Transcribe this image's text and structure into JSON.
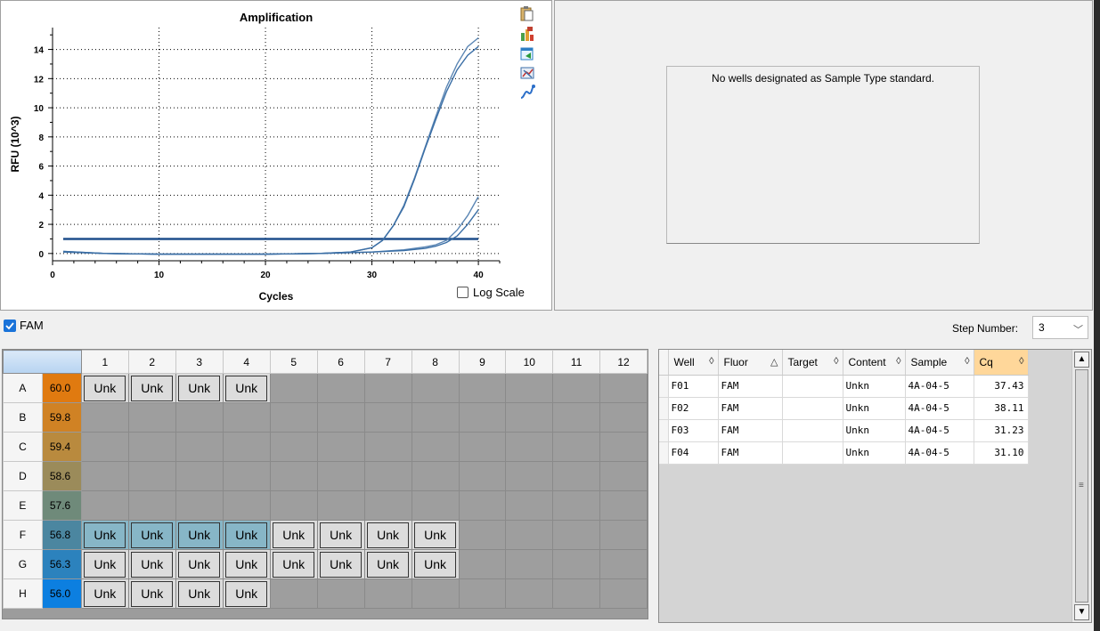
{
  "chart": {
    "title": "Amplification",
    "xlabel": "Cycles",
    "ylabel": "RFU (10^3)",
    "log_scale_label": "Log Scale",
    "tools": [
      "copy-icon",
      "export-chart-icon",
      "export-data-icon",
      "chart-settings-icon",
      "curve-icon"
    ]
  },
  "chart_data": {
    "type": "line",
    "title": "Amplification",
    "xlabel": "Cycles",
    "ylabel": "RFU (10^3)",
    "xlim": [
      0,
      42
    ],
    "ylim": [
      -0.5,
      15.5
    ],
    "xticks": [
      0,
      10,
      20,
      30,
      40
    ],
    "yticks": [
      0,
      2,
      4,
      6,
      8,
      10,
      12,
      14
    ],
    "grid": true,
    "threshold": 1.0,
    "series": [
      {
        "x": [
          1,
          5,
          10,
          15,
          20,
          25,
          28,
          30,
          31,
          32,
          33,
          34,
          35,
          36,
          37,
          38,
          39,
          40
        ],
        "y": [
          0.1,
          0,
          -0.05,
          -0.05,
          -0.05,
          0,
          0.1,
          0.4,
          0.9,
          1.9,
          3.3,
          5.2,
          7.3,
          9.4,
          11.4,
          13.0,
          14.2,
          14.8
        ]
      },
      {
        "x": [
          1,
          5,
          10,
          15,
          20,
          25,
          28,
          30,
          31,
          32,
          33,
          34,
          35,
          36,
          37,
          38,
          39,
          40
        ],
        "y": [
          0.1,
          0,
          -0.05,
          -0.05,
          -0.05,
          0,
          0.1,
          0.4,
          0.9,
          1.9,
          3.2,
          5.1,
          7.2,
          9.2,
          11.1,
          12.6,
          13.6,
          14.2
        ]
      },
      {
        "x": [
          1,
          5,
          10,
          15,
          20,
          25,
          30,
          33,
          35,
          36,
          37,
          38,
          39,
          40
        ],
        "y": [
          0.15,
          0,
          -0.05,
          -0.05,
          -0.05,
          0,
          0.1,
          0.25,
          0.45,
          0.6,
          0.9,
          1.6,
          2.6,
          3.9
        ]
      },
      {
        "x": [
          1,
          5,
          10,
          15,
          20,
          25,
          30,
          33,
          35,
          36,
          37,
          38,
          39,
          40
        ],
        "y": [
          0.15,
          0,
          -0.05,
          -0.05,
          -0.05,
          0,
          0.1,
          0.2,
          0.35,
          0.5,
          0.75,
          1.2,
          2.0,
          3.0
        ]
      }
    ]
  },
  "std_curve": {
    "message": "No wells designated as Sample Type standard."
  },
  "fluor": {
    "label": "FAM",
    "step_label": "Step Number:",
    "step_value": "3"
  },
  "plate": {
    "columns": [
      "1",
      "2",
      "3",
      "4",
      "5",
      "6",
      "7",
      "8",
      "9",
      "10",
      "11",
      "12"
    ],
    "rows": [
      {
        "row": "A",
        "temp": "60.0",
        "color": "#e07a10",
        "wells": [
          "Unk",
          "Unk",
          "Unk",
          "Unk",
          "",
          "",
          "",
          "",
          "",
          "",
          "",
          ""
        ],
        "sel": []
      },
      {
        "row": "B",
        "temp": "59.8",
        "color": "#d08224",
        "wells": [
          "",
          "",
          "",
          "",
          "",
          "",
          "",
          "",
          "",
          "",
          "",
          ""
        ],
        "sel": []
      },
      {
        "row": "C",
        "temp": "59.4",
        "color": "#b98a3e",
        "wells": [
          "",
          "",
          "",
          "",
          "",
          "",
          "",
          "",
          "",
          "",
          "",
          ""
        ],
        "sel": []
      },
      {
        "row": "D",
        "temp": "58.6",
        "color": "#9b8b5a",
        "wells": [
          "",
          "",
          "",
          "",
          "",
          "",
          "",
          "",
          "",
          "",
          "",
          ""
        ],
        "sel": []
      },
      {
        "row": "E",
        "temp": "57.6",
        "color": "#6f8a7a",
        "wells": [
          "",
          "",
          "",
          "",
          "",
          "",
          "",
          "",
          "",
          "",
          "",
          ""
        ],
        "sel": []
      },
      {
        "row": "F",
        "temp": "56.8",
        "color": "#4b86a0",
        "wells": [
          "Unk",
          "Unk",
          "Unk",
          "Unk",
          "Unk",
          "Unk",
          "Unk",
          "Unk",
          "",
          "",
          "",
          ""
        ],
        "sel": [
          0,
          1,
          2,
          3
        ]
      },
      {
        "row": "G",
        "temp": "56.3",
        "color": "#2c82bd",
        "wells": [
          "Unk",
          "Unk",
          "Unk",
          "Unk",
          "Unk",
          "Unk",
          "Unk",
          "Unk",
          "",
          "",
          "",
          ""
        ],
        "sel": []
      },
      {
        "row": "H",
        "temp": "56.0",
        "color": "#0c7fe0",
        "wells": [
          "Unk",
          "Unk",
          "Unk",
          "Unk",
          "",
          "",
          "",
          "",
          "",
          "",
          "",
          ""
        ],
        "sel": []
      }
    ]
  },
  "results": {
    "headers": [
      {
        "label": "Well",
        "sort": "◊"
      },
      {
        "label": "Fluor",
        "sort": "△"
      },
      {
        "label": "Target",
        "sort": "◊"
      },
      {
        "label": "Content",
        "sort": "◊"
      },
      {
        "label": "Sample",
        "sort": "◊"
      },
      {
        "label": "Cq",
        "sort": "◊"
      }
    ],
    "rows": [
      [
        "F01",
        "FAM",
        "",
        "Unkn",
        "4A-04-5",
        "37.43"
      ],
      [
        "F02",
        "FAM",
        "",
        "Unkn",
        "4A-04-5",
        "38.11"
      ],
      [
        "F03",
        "FAM",
        "",
        "Unkn",
        "4A-04-5",
        "31.23"
      ],
      [
        "F04",
        "FAM",
        "",
        "Unkn",
        "4A-04-5",
        "31.10"
      ]
    ]
  }
}
